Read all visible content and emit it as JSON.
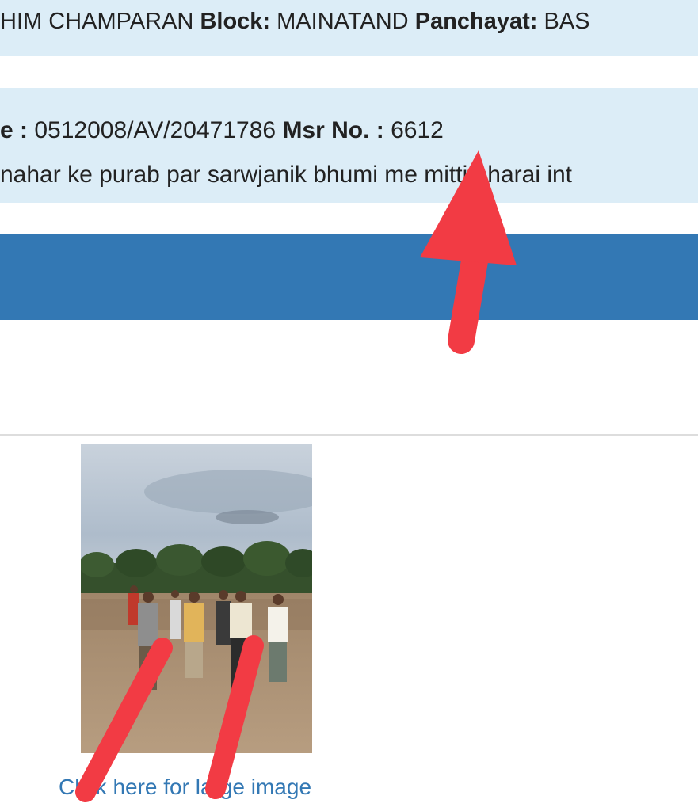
{
  "location_bar": {
    "district_value": "HIM CHAMPARAN",
    "block_label": "Block:",
    "block_value": "MAINATAND",
    "panchayat_label": "Panchayat:",
    "panchayat_value": "BAS"
  },
  "work_bar": {
    "code_label": "e :",
    "code_value": "0512008/AV/20471786",
    "msr_label": "Msr No. :",
    "msr_value": "6612",
    "work_name": "nahar ke purab par sarwjanik bhumi me mitti bharai int"
  },
  "image_section": {
    "link_text": "Click here for large image"
  },
  "annotation": {
    "color": "#f23b44"
  }
}
